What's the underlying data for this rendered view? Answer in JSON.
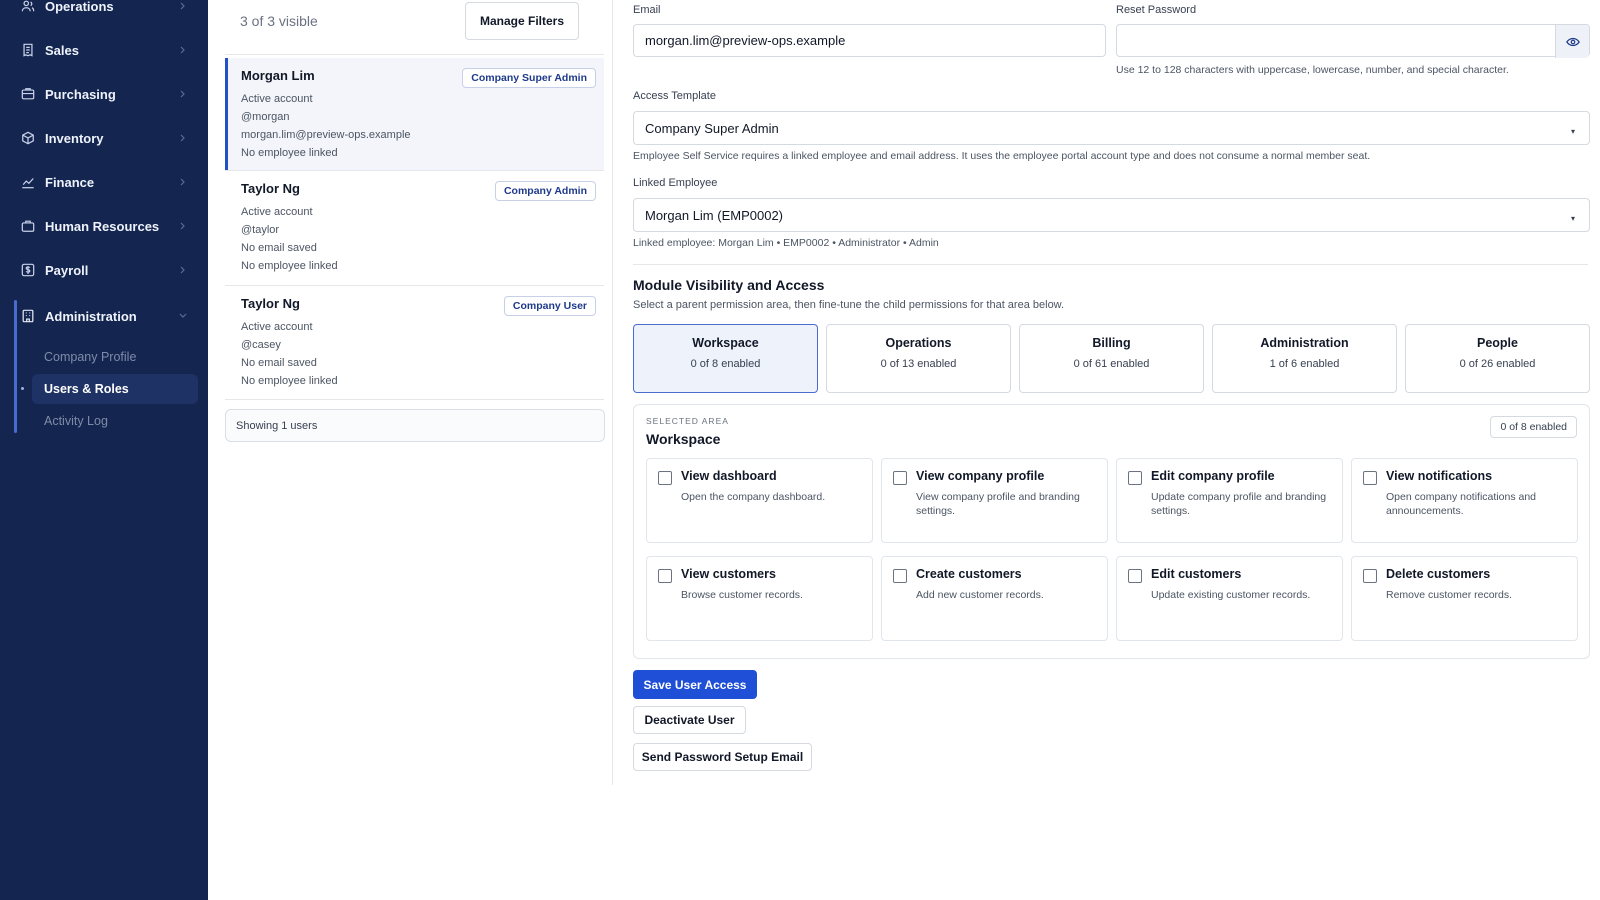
{
  "sidebar": {
    "items": [
      {
        "label": "Operations",
        "icon": "users-icon"
      },
      {
        "label": "Sales",
        "icon": "receipt-icon"
      },
      {
        "label": "Purchasing",
        "icon": "bag-icon"
      },
      {
        "label": "Inventory",
        "icon": "box-icon"
      },
      {
        "label": "Finance",
        "icon": "chart-line-icon"
      },
      {
        "label": "Human Resources",
        "icon": "briefcase-icon"
      },
      {
        "label": "Payroll",
        "icon": "dollar-icon"
      },
      {
        "label": "Administration",
        "icon": "building-icon"
      }
    ],
    "admin_sub": [
      "Company Profile",
      "Users & Roles",
      "Activity Log"
    ],
    "active_sub": "Users & Roles"
  },
  "user_list": {
    "count_text": "3 of 3 visible",
    "manage_filters": "Manage Filters",
    "users": [
      {
        "name": "Morgan Lim",
        "role": "Company Super Admin",
        "status": "Active account",
        "username": "@morgan",
        "email": "morgan.lim@preview-ops.example",
        "employee": "No employee linked",
        "selected": true
      },
      {
        "name": "Taylor Ng",
        "role": "Company Admin",
        "status": "Active account",
        "username": "@taylor",
        "email": "No email saved",
        "employee": "No employee linked",
        "selected": false
      },
      {
        "name": "Taylor Ng",
        "role": "Company User",
        "status": "Active account",
        "username": "@casey",
        "email": "No email saved",
        "employee": "No employee linked",
        "selected": false
      }
    ],
    "showing": "Showing 1 users"
  },
  "form": {
    "email_label": "Email",
    "email_value": "morgan.lim@preview-ops.example",
    "reset_label": "Reset Password",
    "reset_value": "",
    "reset_help": "Use 12 to 128 characters with uppercase, lowercase, number, and special character.",
    "template_label": "Access Template",
    "template_value": "Company Super Admin",
    "template_help": "Employee Self Service requires a linked employee and email address. It uses the employee portal account type and does not consume a normal member seat.",
    "employee_label": "Linked Employee",
    "employee_value": "Morgan Lim (EMP0002)",
    "employee_help": "Linked employee: Morgan Lim • EMP0002 • Administrator • Admin"
  },
  "modules": {
    "title": "Module Visibility and Access",
    "subtitle": "Select a parent permission area, then fine-tune the child permissions for that area below.",
    "areas": [
      {
        "name": "Workspace",
        "count": "0 of 8 enabled",
        "active": true
      },
      {
        "name": "Operations",
        "count": "0 of 13 enabled",
        "active": false
      },
      {
        "name": "Billing",
        "count": "0 of 61 enabled",
        "active": false
      },
      {
        "name": "Administration",
        "count": "1 of 6 enabled",
        "active": false
      },
      {
        "name": "People",
        "count": "0 of 26 enabled",
        "active": false
      }
    ],
    "selected_eyebrow": "SELECTED AREA",
    "selected_name": "Workspace",
    "selected_badge": "0 of 8 enabled",
    "permissions": [
      {
        "title": "View dashboard",
        "desc": "Open the company dashboard.",
        "checked": false
      },
      {
        "title": "View company profile",
        "desc": "View company profile and branding settings.",
        "checked": false
      },
      {
        "title": "Edit company profile",
        "desc": "Update company profile and branding settings.",
        "checked": false
      },
      {
        "title": "View notifications",
        "desc": "Open company notifications and announcements.",
        "checked": false
      },
      {
        "title": "View customers",
        "desc": "Browse customer records.",
        "checked": false
      },
      {
        "title": "Create customers",
        "desc": "Add new customer records.",
        "checked": false
      },
      {
        "title": "Edit customers",
        "desc": "Update existing customer records.",
        "checked": false
      },
      {
        "title": "Delete customers",
        "desc": "Remove customer records.",
        "checked": false
      }
    ]
  },
  "actions": {
    "save": "Save User Access",
    "deactivate": "Deactivate User",
    "send_setup": "Send Password Setup Email"
  },
  "colors": {
    "sidebar_bg": "#142550",
    "primary": "#1f4fd6",
    "selected_border": "#2350c8"
  }
}
